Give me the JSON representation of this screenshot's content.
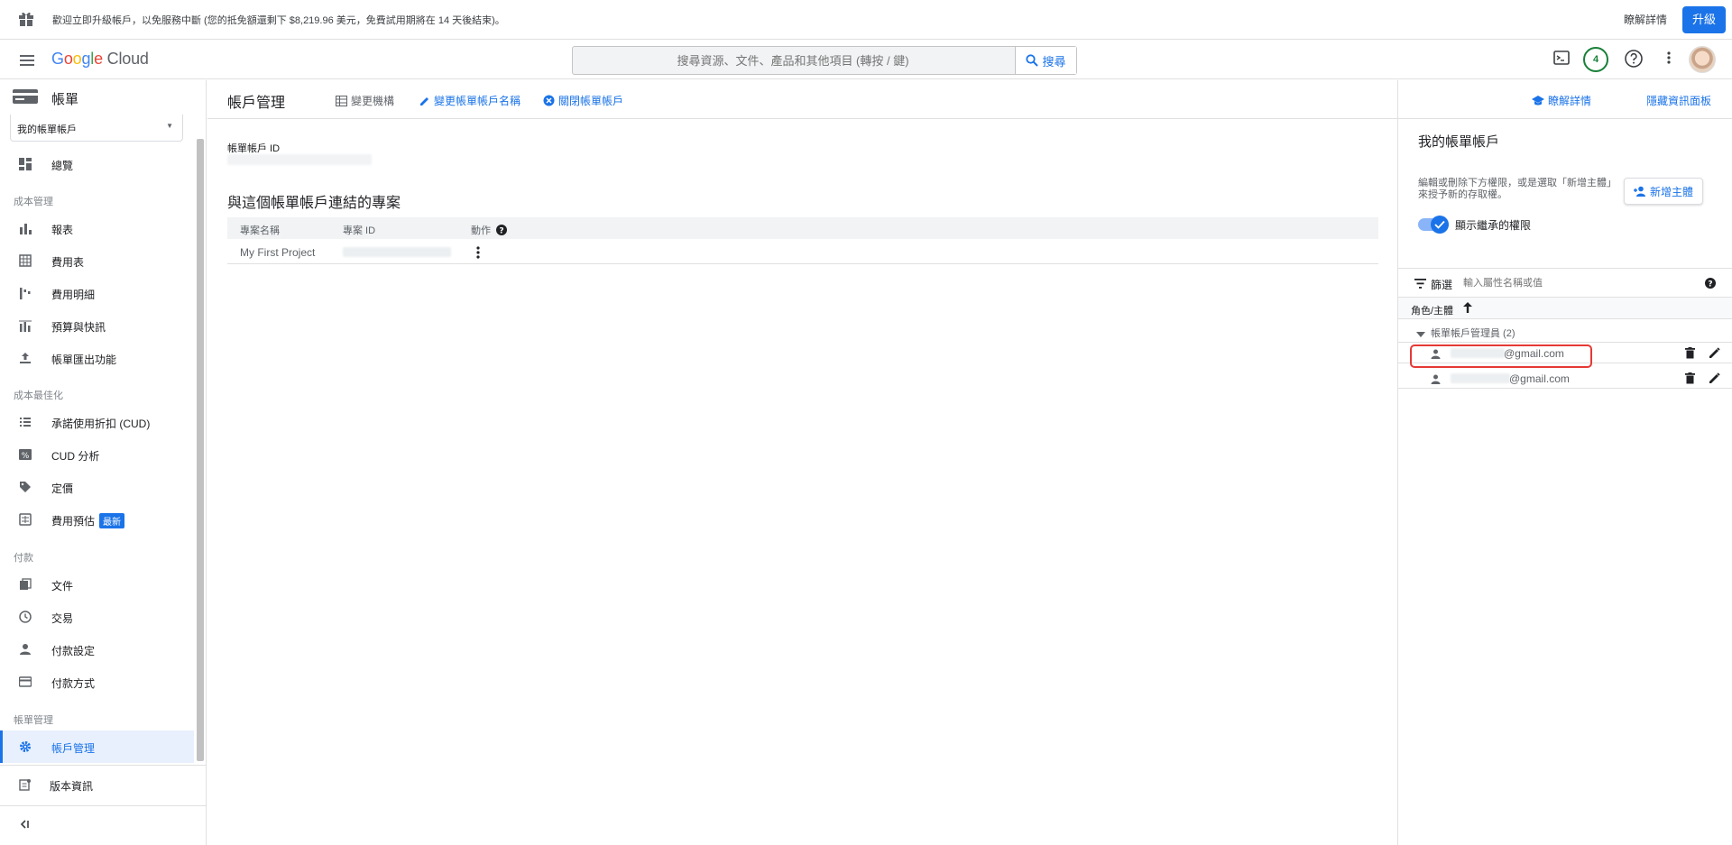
{
  "banner": {
    "text": "歡迎立即升級帳戶，以免服務中斷 (您的抵免額還剩下 $8,219.96 美元，免費試用期將在 14 天後結束)。",
    "learn_more": "瞭解詳情",
    "upgrade": "升級"
  },
  "header": {
    "logo": {
      "g1": "G",
      "o1": "o",
      "o2": "o",
      "g2": "g",
      "l": "l",
      "e": "e",
      "cloud": " Cloud"
    },
    "search_placeholder": "搜尋資源、文件、產品和其他項目 (轉按 / 鍵)",
    "search_button": "搜尋",
    "notification_count": "4"
  },
  "sidebar": {
    "title": "帳單",
    "account_select": "我的帳單帳戶",
    "overview": "總覽",
    "sections": {
      "cost_management": "成本管理",
      "cost_optimization": "成本最佳化",
      "payments": "付款",
      "billing_management": "帳單管理"
    },
    "items": {
      "reports": "報表",
      "cost_table": "費用表",
      "cost_breakdown": "費用明細",
      "budgets": "預算與快訊",
      "export": "帳單匯出功能",
      "cud": "承諾使用折扣 (CUD)",
      "cud_analysis": "CUD 分析",
      "pricing": "定價",
      "estimate": "費用預估",
      "new_badge": "最新",
      "documents": "文件",
      "transactions": "交易",
      "payment_settings": "付款設定",
      "payment_method": "付款方式",
      "account_management": "帳戶管理",
      "release_notes": "版本資訊"
    }
  },
  "main": {
    "title": "帳戶管理",
    "actions": {
      "change_org": "變更機構",
      "rename": "變更帳單帳戶名稱",
      "close": "關閉帳單帳戶"
    },
    "billing_id_label": "帳單帳戶 ID",
    "projects_title": "與這個帳單帳戶連結的專案",
    "table": {
      "headers": [
        "專案名稱",
        "專案 ID",
        "動作"
      ],
      "rows": [
        {
          "name": "My First Project"
        }
      ]
    }
  },
  "panel": {
    "learn_more": "瞭解詳情",
    "hide_panel": "隱藏資訊面板",
    "title": "我的帳單帳戶",
    "description": "編輯或刪除下方權限，或是選取「新增主體」來授予新的存取權。",
    "add_principal": "新增主體",
    "show_inherited": "顯示繼承的權限",
    "filter_label": "篩選",
    "filter_placeholder": "輸入屬性名稱或值",
    "column_header": "角色/主體",
    "group": "帳單帳戶管理員 (2)",
    "members": [
      {
        "email": "@gmail.com"
      },
      {
        "email": "@gmail.com"
      }
    ]
  },
  "colors": {
    "accent": "#1a73e8",
    "highlight": "#e53935",
    "active_bg": "#e8f0fe"
  }
}
